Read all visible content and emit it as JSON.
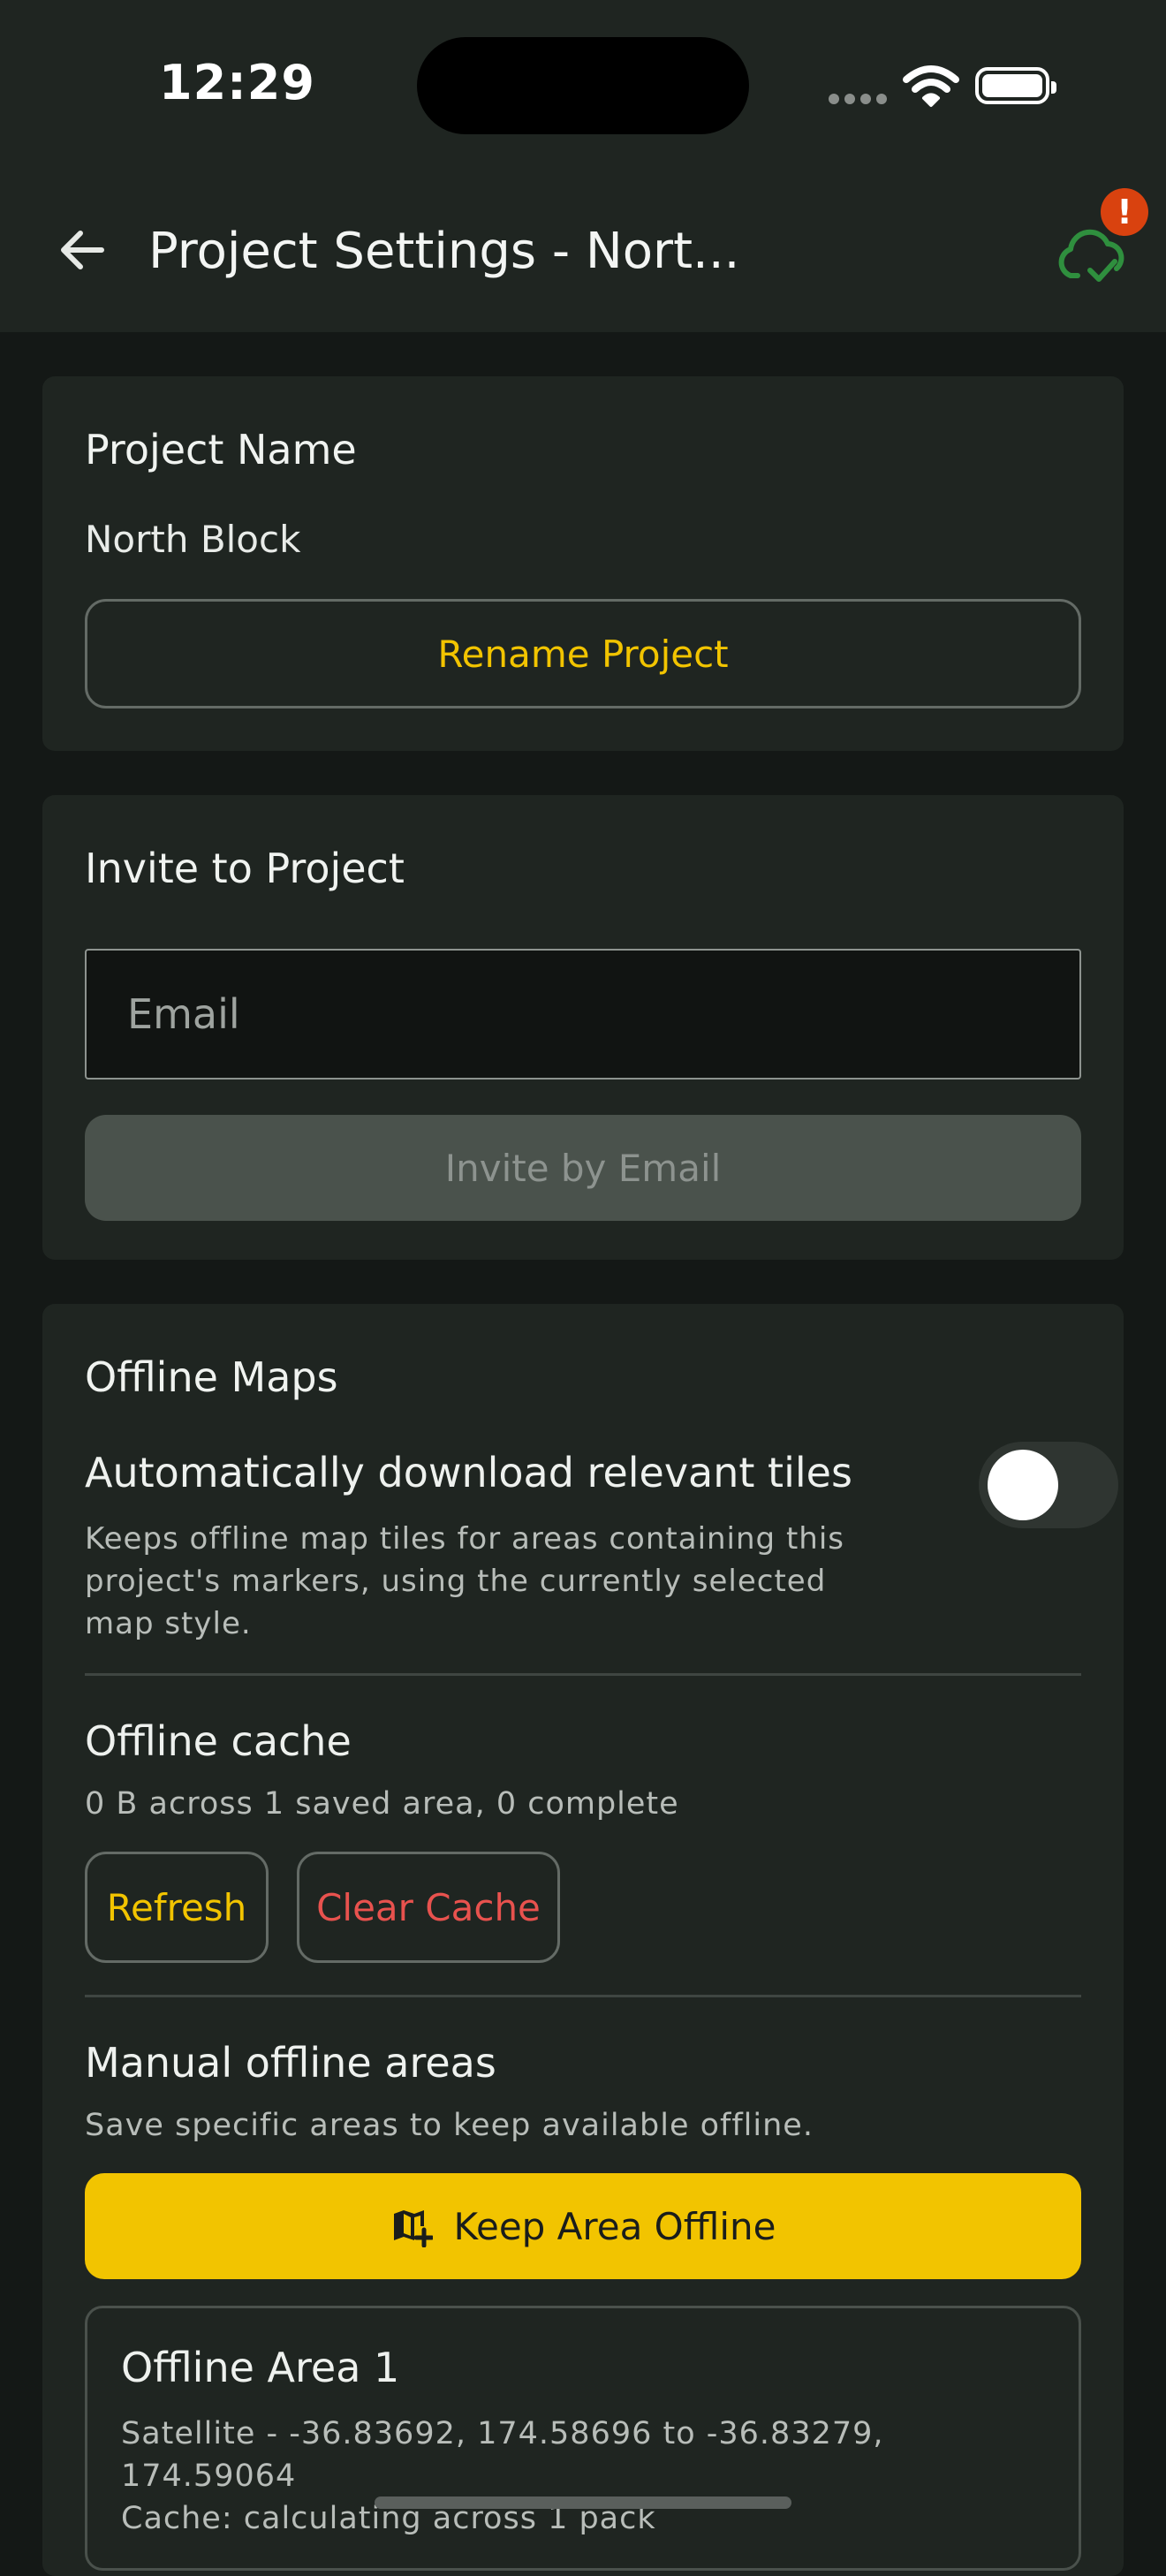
{
  "status_bar": {
    "time": "12:29"
  },
  "app_bar": {
    "title": "Project Settings - Nort...",
    "sync_badge": "!"
  },
  "project_name": {
    "heading": "Project Name",
    "value": "North Block",
    "rename_button": "Rename Project"
  },
  "invite": {
    "heading": "Invite to Project",
    "email_placeholder": "Email",
    "email_value": "",
    "invite_button": "Invite by Email"
  },
  "offline_maps": {
    "heading": "Offline Maps",
    "auto_download": {
      "label": "Automatically download relevant tiles",
      "description_lines": [
        "Keeps offline map tiles for areas containing this",
        "project's markers, using the currently selected",
        "map style."
      ],
      "enabled": false
    },
    "cache": {
      "label": "Offline cache",
      "summary": "0 B across 1 saved area, 0 complete",
      "refresh_button": "Refresh",
      "clear_button": "Clear Cache"
    },
    "manual": {
      "label": "Manual offline areas",
      "description": "Save specific areas to keep available offline.",
      "keep_button": "Keep Area Offline",
      "areas": [
        {
          "title": "Offline Area 1",
          "detail_lines": [
            "Satellite - -36.83692, 174.58696 to -36.83279,",
            "174.59064"
          ],
          "cache_status": "Cache: calculating across 1 pack"
        }
      ]
    }
  },
  "colors": {
    "background": "#141816",
    "card": "#1f2521",
    "accent": "#f2c400",
    "danger": "#e8524e",
    "sync_ok": "#2f8f3e",
    "sync_badge": "#d9420f"
  }
}
